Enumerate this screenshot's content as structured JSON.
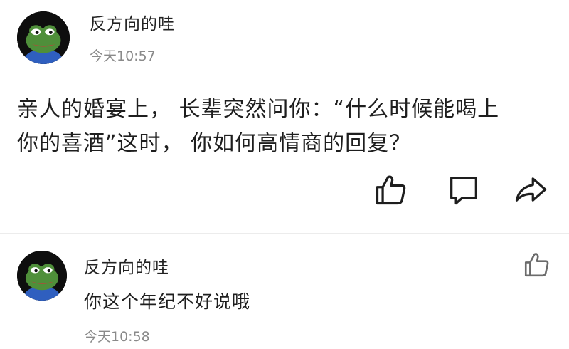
{
  "post": {
    "author": "反方向的哇",
    "time": "今天10:57",
    "body_lines": [
      "亲人的婚宴上， 长辈突然问你：“什么时候能喝上",
      "你的喜酒”这时， 你如何高情商的回复？"
    ],
    "actions": {
      "like_icon": "thumbs-up-icon",
      "comment_icon": "comment-icon",
      "share_icon": "share-icon"
    }
  },
  "comment": {
    "author": "反方向的哇",
    "text": "你这个年纪不好说哦",
    "time": "今天10:58",
    "like_icon": "thumbs-up-icon"
  },
  "colors": {
    "text": "#1e1e1e",
    "meta": "#8a8a8a",
    "avatar_frog": "#4f8f3a",
    "avatar_bg": "#0e0e0e",
    "avatar_shirt": "#2f5fbf"
  }
}
